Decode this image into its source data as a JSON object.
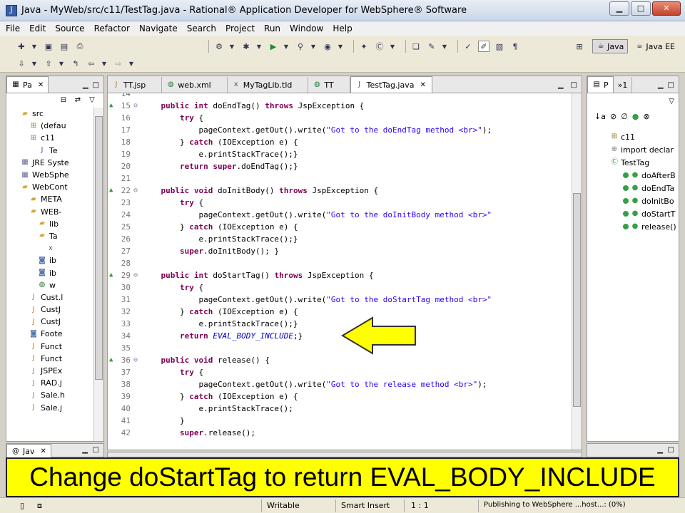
{
  "window": {
    "title": "Java - MyWeb/src/c11/TestTag.java - Rational® Application Developer for WebSphere® Software",
    "minimize": "▁",
    "maximize": "□",
    "close": "✕"
  },
  "menu": [
    "File",
    "Edit",
    "Source",
    "Refactor",
    "Navigate",
    "Search",
    "Project",
    "Run",
    "Window",
    "Help"
  ],
  "perspectives": {
    "java": "Java",
    "javaee": "Java EE"
  },
  "package_explorer": {
    "tab_label": "Pa",
    "items": [
      {
        "label": "src",
        "icon": "folder-icon",
        "indent": 2
      },
      {
        "label": "(defau",
        "icon": "package-icon",
        "indent": 3
      },
      {
        "label": "c11",
        "icon": "package-icon",
        "indent": 3
      },
      {
        "label": "Te",
        "icon": "java-file-icon",
        "indent": 4
      },
      {
        "label": "JRE Syste",
        "icon": "library-icon",
        "indent": 2
      },
      {
        "label": "WebSphe",
        "icon": "library-icon",
        "indent": 2
      },
      {
        "label": "WebCont",
        "icon": "folder-icon",
        "indent": 2
      },
      {
        "label": "META",
        "icon": "folder-icon",
        "indent": 3
      },
      {
        "label": "WEB-",
        "icon": "folder-icon",
        "indent": 3
      },
      {
        "label": "lib",
        "icon": "folder-icon",
        "indent": 4
      },
      {
        "label": "Ta",
        "icon": "folder-icon",
        "indent": 4
      },
      {
        "label": "",
        "icon": "xml-file-icon",
        "indent": 5
      },
      {
        "label": "ib",
        "icon": "file-icon",
        "indent": 4
      },
      {
        "label": "ib",
        "icon": "file-icon",
        "indent": 4
      },
      {
        "label": "w",
        "icon": "web-icon",
        "indent": 4
      },
      {
        "label": "Cust.l",
        "icon": "jsp-file-icon",
        "indent": 3
      },
      {
        "label": "CustJ",
        "icon": "jsp-file-icon",
        "indent": 3
      },
      {
        "label": "CustJ",
        "icon": "jsp-file-icon",
        "indent": 3
      },
      {
        "label": "Foote",
        "icon": "file-icon",
        "indent": 3
      },
      {
        "label": "Funct",
        "icon": "jsp-file-icon",
        "indent": 3
      },
      {
        "label": "Funct",
        "icon": "jsp-file-icon",
        "indent": 3
      },
      {
        "label": "JSPEx",
        "icon": "jsp-file-icon",
        "indent": 3
      },
      {
        "label": "RAD.j",
        "icon": "jsp-file-icon",
        "indent": 3
      },
      {
        "label": "Sale.h",
        "icon": "jsp-file-icon",
        "indent": 3
      },
      {
        "label": "Sale.j",
        "icon": "jsp-file-icon",
        "indent": 3
      }
    ],
    "javadoc_tab": "Jav"
  },
  "editor": {
    "tabs": [
      {
        "label": "TT.jsp",
        "icon": "jsp-file-icon",
        "active": false
      },
      {
        "label": "web.xml",
        "icon": "web-icon",
        "active": false
      },
      {
        "label": "MyTagLib.tld",
        "icon": "xml-file-icon",
        "active": false
      },
      {
        "label": "TT",
        "icon": "web-icon",
        "active": false
      },
      {
        "label": "TestTag.java",
        "icon": "java-file-icon",
        "active": true
      }
    ],
    "lines": [
      {
        "n": "14",
        "marker": "",
        "code": []
      },
      {
        "n": "15",
        "marker": "override",
        "code": [
          [
            "    ",
            ""
          ],
          [
            "public int",
            "kw"
          ],
          [
            " doEndTag() ",
            ""
          ],
          [
            "throws",
            "kw"
          ],
          [
            " JspException {",
            ""
          ]
        ]
      },
      {
        "n": "16",
        "marker": "",
        "code": [
          [
            "        ",
            ""
          ],
          [
            "try",
            "kw"
          ],
          [
            " {",
            ""
          ]
        ]
      },
      {
        "n": "17",
        "marker": "",
        "code": [
          [
            "            pageContext.getOut().write(",
            ""
          ],
          [
            "\"Got to the doEndTag method <br>\"",
            "str"
          ],
          [
            ");",
            ""
          ]
        ]
      },
      {
        "n": "18",
        "marker": "",
        "code": [
          [
            "        } ",
            ""
          ],
          [
            "catch",
            "kw"
          ],
          [
            " (IOException e) {",
            ""
          ]
        ]
      },
      {
        "n": "19",
        "marker": "",
        "code": [
          [
            "            e.printStackTrace();}",
            ""
          ]
        ]
      },
      {
        "n": "20",
        "marker": "",
        "code": [
          [
            "        ",
            ""
          ],
          [
            "return super",
            "kw"
          ],
          [
            ".doEndTag();}",
            ""
          ]
        ]
      },
      {
        "n": "21",
        "marker": "",
        "code": []
      },
      {
        "n": "22",
        "marker": "override",
        "code": [
          [
            "    ",
            ""
          ],
          [
            "public void",
            "kw"
          ],
          [
            " doInitBody() ",
            ""
          ],
          [
            "throws",
            "kw"
          ],
          [
            " JspException {",
            ""
          ]
        ]
      },
      {
        "n": "23",
        "marker": "",
        "code": [
          [
            "        ",
            ""
          ],
          [
            "try",
            "kw"
          ],
          [
            " {",
            ""
          ]
        ]
      },
      {
        "n": "24",
        "marker": "",
        "code": [
          [
            "            pageContext.getOut().write(",
            ""
          ],
          [
            "\"Got to the doInitBody method <br>\"",
            "str"
          ]
        ]
      },
      {
        "n": "25",
        "marker": "",
        "code": [
          [
            "        } ",
            ""
          ],
          [
            "catch",
            "kw"
          ],
          [
            " (IOException e) {",
            ""
          ]
        ]
      },
      {
        "n": "26",
        "marker": "",
        "code": [
          [
            "            e.printStackTrace();}",
            ""
          ]
        ]
      },
      {
        "n": "27",
        "marker": "",
        "code": [
          [
            "        ",
            ""
          ],
          [
            "super",
            "kw"
          ],
          [
            ".doInitBody(); }",
            ""
          ]
        ]
      },
      {
        "n": "28",
        "marker": "",
        "code": []
      },
      {
        "n": "29",
        "marker": "override",
        "code": [
          [
            "    ",
            ""
          ],
          [
            "public int",
            "kw"
          ],
          [
            " doStartTag() ",
            ""
          ],
          [
            "throws",
            "kw"
          ],
          [
            " JspException {",
            ""
          ]
        ]
      },
      {
        "n": "30",
        "marker": "",
        "code": [
          [
            "        ",
            ""
          ],
          [
            "try",
            "kw"
          ],
          [
            " {",
            ""
          ]
        ]
      },
      {
        "n": "31",
        "marker": "",
        "code": [
          [
            "            pageContext.getOut().write(",
            ""
          ],
          [
            "\"Got to the doStartTag method <br>\"",
            "str"
          ]
        ]
      },
      {
        "n": "32",
        "marker": "",
        "code": [
          [
            "        } ",
            ""
          ],
          [
            "catch",
            "kw"
          ],
          [
            " (IOException e) {",
            ""
          ]
        ]
      },
      {
        "n": "33",
        "marker": "",
        "code": [
          [
            "            e.printStackTrace();}",
            ""
          ]
        ]
      },
      {
        "n": "34",
        "marker": "",
        "code": [
          [
            "        ",
            ""
          ],
          [
            "return",
            "kw"
          ],
          [
            " ",
            ""
          ],
          [
            "EVAL_BODY_INCLUDE",
            "it"
          ],
          [
            ";}",
            ""
          ]
        ]
      },
      {
        "n": "35",
        "marker": "",
        "code": []
      },
      {
        "n": "36",
        "marker": "override",
        "code": [
          [
            "    ",
            ""
          ],
          [
            "public void",
            "kw"
          ],
          [
            " release() {",
            ""
          ]
        ]
      },
      {
        "n": "37",
        "marker": "",
        "code": [
          [
            "        ",
            ""
          ],
          [
            "try",
            "kw"
          ],
          [
            " {",
            ""
          ]
        ]
      },
      {
        "n": "38",
        "marker": "",
        "code": [
          [
            "            pageContext.getOut().write(",
            ""
          ],
          [
            "\"Got to the release method <br>\"",
            "str"
          ],
          [
            ");",
            ""
          ]
        ]
      },
      {
        "n": "39",
        "marker": "",
        "code": [
          [
            "        } ",
            ""
          ],
          [
            "catch",
            "kw"
          ],
          [
            " (IOException e) {",
            ""
          ]
        ]
      },
      {
        "n": "40",
        "marker": "",
        "code": [
          [
            "            e.printStackTrace();",
            ""
          ]
        ]
      },
      {
        "n": "41",
        "marker": "",
        "code": [
          [
            "        }",
            ""
          ]
        ]
      },
      {
        "n": "42",
        "marker": "",
        "code": [
          [
            "        ",
            ""
          ],
          [
            "super",
            "kw"
          ],
          [
            ".release();",
            ""
          ]
        ]
      }
    ]
  },
  "outline": {
    "tab_label": "P",
    "tab2_label": "»1",
    "items": [
      {
        "label": "c11",
        "icon": "package-icon",
        "indent": 0,
        "dot": false
      },
      {
        "label": "import declar",
        "icon": "import-icon",
        "indent": 0,
        "dot": false
      },
      {
        "label": "TestTag",
        "icon": "class-icon",
        "indent": 0,
        "dot": false
      },
      {
        "label": "doAfterB",
        "icon": "method-icon",
        "indent": 1,
        "dot": true
      },
      {
        "label": "doEndTa",
        "icon": "method-icon",
        "indent": 1,
        "dot": true
      },
      {
        "label": "doInitBo",
        "icon": "method-icon",
        "indent": 1,
        "dot": true
      },
      {
        "label": "doStartT",
        "icon": "method-icon",
        "indent": 1,
        "dot": true
      },
      {
        "label": "release()",
        "icon": "method-icon",
        "indent": 1,
        "dot": true
      }
    ]
  },
  "caption": "Change doStartTag to return EVAL_BODY_INCLUDE",
  "status": {
    "writable": "Writable",
    "insert_mode": "Smart Insert",
    "position": "1 : 1",
    "publishing": "Publishing to WebSphere ...host...: (0%)"
  },
  "colors": {
    "arrow_fill": "#ffff00",
    "banner_bg": "#ffff00",
    "keyword": "#7f0055",
    "string": "#2a00ff"
  }
}
